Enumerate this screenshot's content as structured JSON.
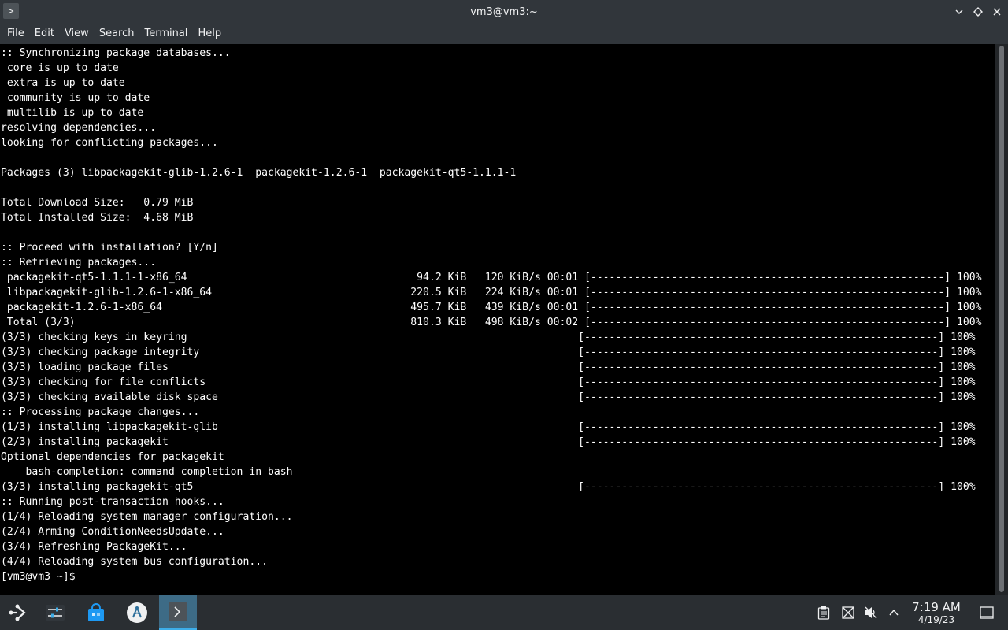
{
  "window": {
    "title": "vm3@vm3:~"
  },
  "menu": [
    "File",
    "Edit",
    "View",
    "Search",
    "Terminal",
    "Help"
  ],
  "terminal": {
    "lines": [
      ":: Synchronizing package databases...",
      " core is up to date",
      " extra is up to date",
      " community is up to date",
      " multilib is up to date",
      "resolving dependencies...",
      "looking for conflicting packages...",
      "",
      "Packages (3) libpackagekit-glib-1.2.6-1  packagekit-1.2.6-1  packagekit-qt5-1.1.1-1",
      "",
      "Total Download Size:   0.79 MiB",
      "Total Installed Size:  4.68 MiB",
      "",
      ":: Proceed with installation? [Y/n]",
      ":: Retrieving packages...",
      " packagekit-qt5-1.1.1-1-x86_64                                     94.2 KiB   120 KiB/s 00:01 [---------------------------------------------------------] 100%",
      " libpackagekit-glib-1.2.6-1-x86_64                                220.5 KiB   224 KiB/s 00:01 [---------------------------------------------------------] 100%",
      " packagekit-1.2.6-1-x86_64                                        495.7 KiB   439 KiB/s 00:01 [---------------------------------------------------------] 100%",
      " Total (3/3)                                                      810.3 KiB   498 KiB/s 00:02 [---------------------------------------------------------] 100%",
      "(3/3) checking keys in keyring                                                               [---------------------------------------------------------] 100%",
      "(3/3) checking package integrity                                                             [---------------------------------------------------------] 100%",
      "(3/3) loading package files                                                                  [---------------------------------------------------------] 100%",
      "(3/3) checking for file conflicts                                                            [---------------------------------------------------------] 100%",
      "(3/3) checking available disk space                                                          [---------------------------------------------------------] 100%",
      ":: Processing package changes...",
      "(1/3) installing libpackagekit-glib                                                          [---------------------------------------------------------] 100%",
      "(2/3) installing packagekit                                                                  [---------------------------------------------------------] 100%",
      "Optional dependencies for packagekit",
      "    bash-completion: command completion in bash",
      "(3/3) installing packagekit-qt5                                                              [---------------------------------------------------------] 100%",
      ":: Running post-transaction hooks...",
      "(1/4) Reloading system manager configuration...",
      "(2/4) Arming ConditionNeedsUpdate...",
      "(3/4) Refreshing PackageKit...",
      "(4/4) Reloading system bus configuration...",
      "[vm3@vm3 ~]$ "
    ]
  },
  "taskbar": {
    "time": "7:19 AM",
    "date": "4/19/23",
    "pinned": [
      "application-launcher-icon",
      "settings-icon",
      "discover-store-icon",
      "steam-icon",
      "terminal-icon"
    ],
    "tray": [
      "clipboard-icon",
      "network-icon",
      "volume-muted-icon",
      "tray-expand-icon",
      "show-desktop-icon"
    ]
  },
  "colors": {
    "terminal_bg": "#000000",
    "terminal_fg": "#ffffff",
    "chrome_bg": "#31363b",
    "taskbar_bg": "#2a2e32",
    "active_task": "#3d6b86"
  }
}
